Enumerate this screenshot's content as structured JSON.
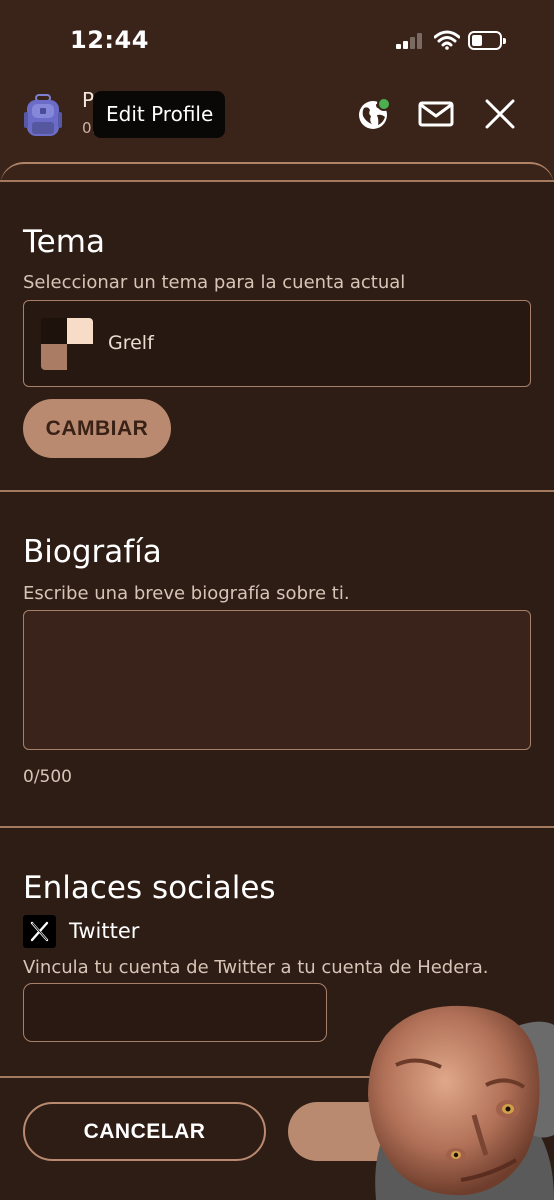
{
  "status_bar": {
    "time": "12:44"
  },
  "header": {
    "profile_name_initial": "P",
    "profile_sub_initial": "0.",
    "tooltip": "Edit Profile",
    "icons": [
      "backpack-avatar-icon",
      "globe-icon",
      "mail-icon",
      "close-icon"
    ],
    "online_dot_color": "#4caf50"
  },
  "theme": {
    "title": "Tema",
    "description": "Seleccionar un tema para la cuenta actual",
    "selected_theme": "Grelf",
    "change_button": "CAMBIAR"
  },
  "bio": {
    "title": "Biografía",
    "description": "Escribe una breve biografía sobre ti.",
    "value": "",
    "counter": "0/500"
  },
  "social": {
    "title": "Enlaces sociales",
    "twitter_label": "Twitter",
    "description": "Vincula tu cuenta de Twitter a tu cuenta de Hedera.",
    "twitter_value": ""
  },
  "footer": {
    "cancel_button": "CANCELAR"
  },
  "colors": {
    "background": "#3a241a",
    "panel": "#2e1d15",
    "accent": "#b98a70",
    "border": "#a7806a"
  }
}
